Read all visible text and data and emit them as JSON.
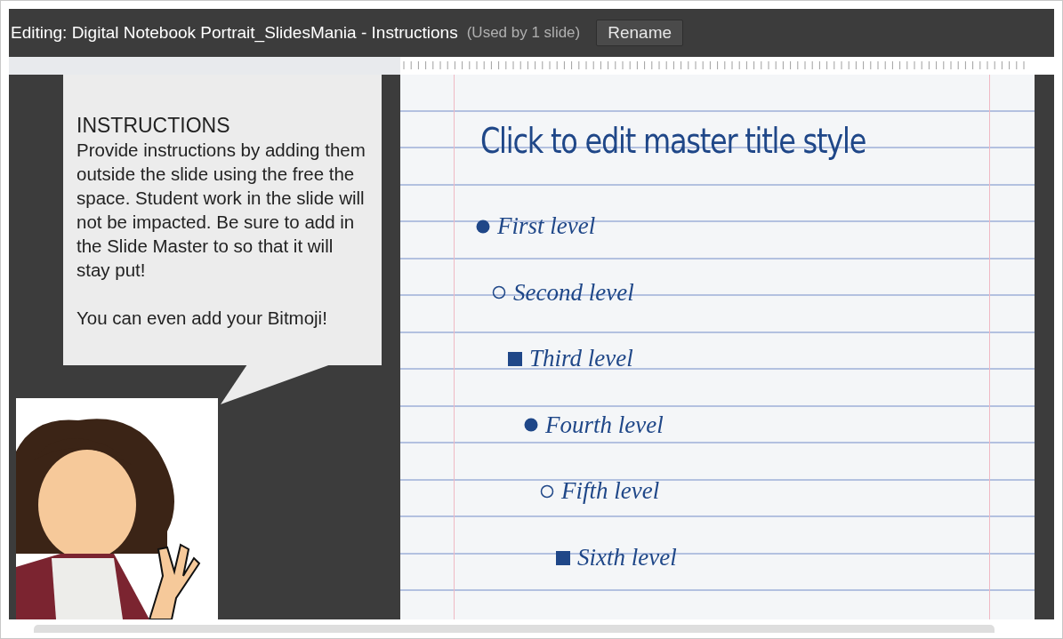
{
  "header": {
    "title": "Editing: Digital Notebook Portrait_SlidesMania - Instructions",
    "usage": "(Used by 1 slide)",
    "rename_button": "Rename"
  },
  "callout": {
    "heading": "INSTRUCTIONS",
    "paragraphs": [
      "Provide instructions by adding them outside the slide using the free the space. Student work in the slide will not be impacted. Be sure to add in the Slide Master to so that it will stay put!",
      "You can even add your Bitmoji!"
    ]
  },
  "slide": {
    "title": "Click to edit master title style",
    "levels": [
      {
        "text": "First level",
        "kind": "disc"
      },
      {
        "text": "Second level",
        "kind": "circle"
      },
      {
        "text": "Third level",
        "kind": "square"
      },
      {
        "text": "Fourth level",
        "kind": "disc"
      },
      {
        "text": "Fifth level",
        "kind": "circle"
      },
      {
        "text": "Sixth level",
        "kind": "square"
      }
    ]
  }
}
